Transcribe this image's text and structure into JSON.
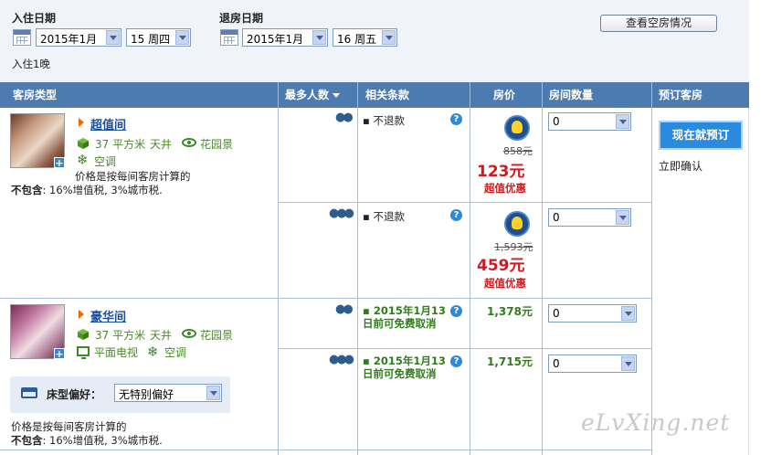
{
  "search": {
    "checkin_label": "入住日期",
    "checkin_month": "2015年1月",
    "checkin_day": "15 周四",
    "checkout_label": "退房日期",
    "checkout_month": "2015年1月",
    "checkout_day": "16 周五",
    "check_button": "查看空房情况",
    "nights": "入住1晚"
  },
  "table": {
    "headers": [
      "客房类型",
      "最多人数",
      "相关条款",
      "房价",
      "房间数量",
      "预订客房"
    ]
  },
  "rooms": [
    {
      "name": "超值间",
      "area": "37 平方米",
      "f_patio": "天井",
      "f_view": "花园景",
      "f_ac": "空调",
      "price_note": "价格是按每间客房计算的",
      "excl_label": "不包含",
      "excl_text": ": 16%增值税, 3%城市税.",
      "rates": [
        {
          "occupancy": "2",
          "policy": "不退款",
          "original": "858元",
          "price": "123元",
          "deal": "超值优惠",
          "qty": "0"
        },
        {
          "occupancy": "3",
          "policy": "不退款",
          "original": "1,593元",
          "price": "459元",
          "deal": "超值优惠",
          "qty": "0"
        }
      ]
    },
    {
      "name": "豪华间",
      "area": "37 平方米",
      "f_patio": "天井",
      "f_view": "花园景",
      "f_tv": "平面电视",
      "f_ac": "空调",
      "bed_label": "床型偏好：",
      "bed_value": "无特别偏好",
      "price_note": "价格是按每间客房计算的",
      "excl_label": "不包含",
      "excl_text": ": 16%增值税, 3%城市税.",
      "rates": [
        {
          "occupancy": "2",
          "policy": "2015年1月13日前可免费取消",
          "price": "1,378元",
          "qty": "0"
        },
        {
          "occupancy": "3",
          "policy": "2015年1月13日前可免费取消",
          "price": "1,715元",
          "qty": "0"
        }
      ]
    }
  ],
  "booking": {
    "button": "现在就预订",
    "confirm": "立即确认"
  },
  "watermark": "eLvXing.net"
}
